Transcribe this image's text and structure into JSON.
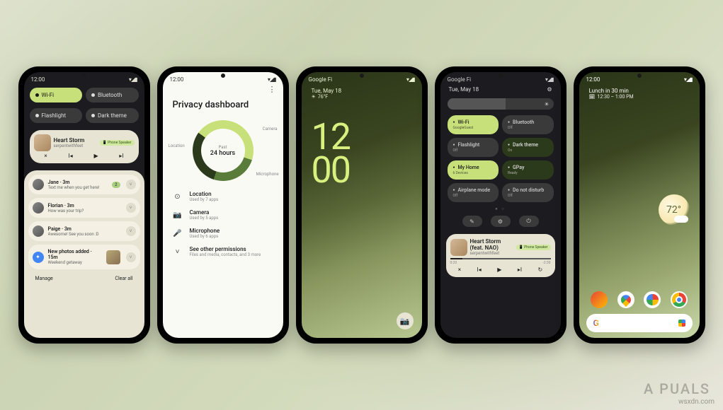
{
  "watermark": "wsxdn.com",
  "brand_logo": "A PUALS",
  "status_icons": "▾◢▮",
  "phone1": {
    "time": "12:00",
    "qs": {
      "wifi": "Wi-Fi",
      "bluetooth": "Bluetooth",
      "flashlight": "Flashlight",
      "dark": "Dark theme"
    },
    "media": {
      "title": "Heart Storm",
      "artist": "serpentwithfeet",
      "output": "📱 Phone Speaker"
    },
    "notifs": [
      {
        "name": "Jane",
        "time": "3m",
        "msg": "Text me when you get here!",
        "badge": "2"
      },
      {
        "name": "Florian",
        "time": "3m",
        "msg": "How was your trip?"
      },
      {
        "name": "Paige",
        "time": "3m",
        "msg": "Awesome! See you soon :D"
      },
      {
        "name": "New photos added",
        "time": "15m",
        "msg": "Weekend getaway",
        "thumb": true
      }
    ],
    "manage": "Manage",
    "clear": "Clear all"
  },
  "phone2": {
    "time": "12:00",
    "title": "Privacy dashboard",
    "donut": {
      "label": "Past",
      "period": "24 hours",
      "l_loc": "Location",
      "l_cam": "Camera",
      "l_mic": "Microphone"
    },
    "perms": [
      {
        "icon": "⊙",
        "title": "Location",
        "sub": "Used by 7 apps"
      },
      {
        "icon": "📷",
        "title": "Camera",
        "sub": "Used by 5 apps"
      },
      {
        "icon": "🎤",
        "title": "Microphone",
        "sub": "Used by 6 apps"
      },
      {
        "icon": "˅",
        "title": "See other permissions",
        "sub": "Files and media, contacts, and 3 more"
      }
    ]
  },
  "phone3": {
    "carrier": "Google Fi",
    "date": "Tue, May 18",
    "temp": "76°F",
    "clock_h": "12",
    "clock_m": "00"
  },
  "phone4": {
    "carrier": "Google Fi",
    "date": "Tue, May 18",
    "tiles": [
      {
        "title": "Wi-Fi",
        "sub": "GoogleGuest",
        "active": true
      },
      {
        "title": "Bluetooth",
        "sub": "Off"
      },
      {
        "title": "Flashlight",
        "sub": "Off"
      },
      {
        "title": "Dark theme",
        "sub": "On",
        "alt": true
      },
      {
        "title": "My Home",
        "sub": "6 Devices",
        "active": true
      },
      {
        "title": "GPay",
        "sub": "Ready",
        "alt": true
      },
      {
        "title": "Airplane mode",
        "sub": "Off"
      },
      {
        "title": "Do not disturb",
        "sub": "Off"
      }
    ],
    "media": {
      "title": "Heart Storm (feat. NAO)",
      "artist": "serpentwithfeet",
      "output": "📱 Phone Speaker",
      "t1": "0:20",
      "t2": "-2:30"
    }
  },
  "phone5": {
    "time": "12:00",
    "glance": "Lunch in 30 min",
    "glance_sub": "12:30 – 1:00 PM",
    "temp": "72°"
  }
}
